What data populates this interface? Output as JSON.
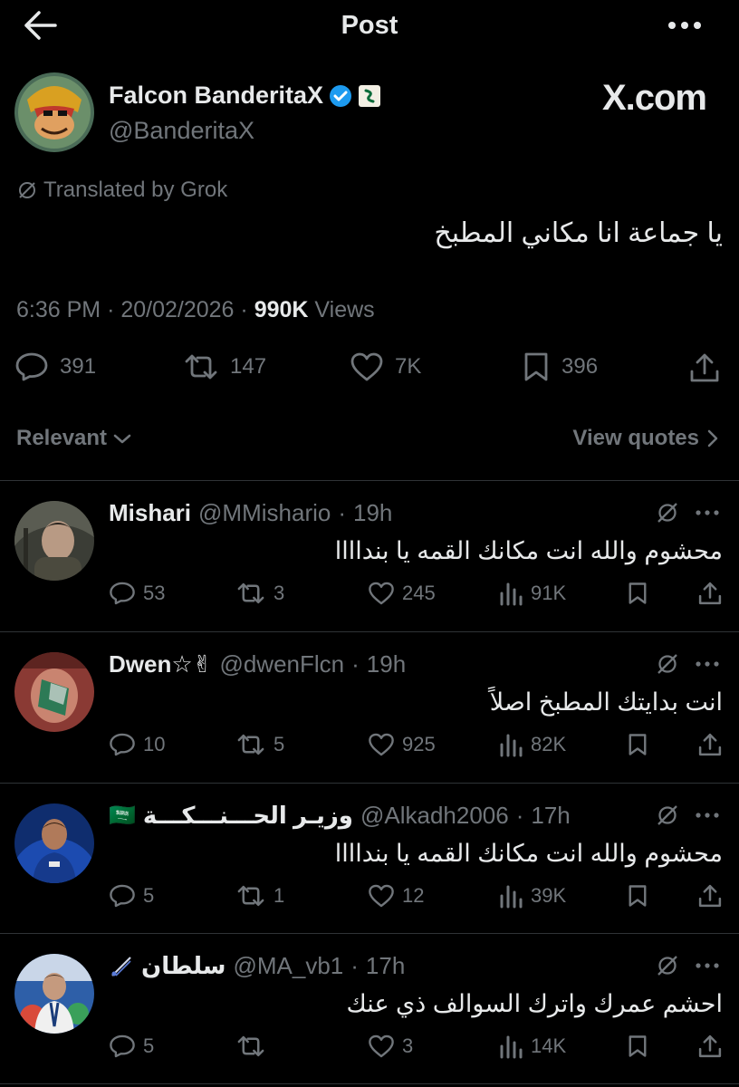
{
  "header": {
    "title": "Post"
  },
  "author": {
    "name": "Falcon BanderitaX",
    "handle": "@BanderitaX",
    "site": "X.com"
  },
  "post": {
    "translated_label": "Translated by Grok",
    "text": "يا جماعة انا مكاني المطبخ",
    "time": "6:36 PM",
    "date": "20/02/2026",
    "views_count": "990K",
    "views_label": "Views",
    "stats": {
      "replies": "391",
      "reposts": "147",
      "likes": "7K",
      "bookmarks": "396"
    }
  },
  "filter": {
    "relevant": "Relevant",
    "view_quotes": "View quotes"
  },
  "colors": {
    "verified": "#1d9bf0",
    "background": "#000000",
    "muted": "#71767b",
    "text": "#e7e9ea"
  },
  "replies": [
    {
      "name": "Mishari",
      "handle": "@MMishario",
      "time": "19h",
      "text": "محشوم والله انت مكانك القمه يا بنداااا",
      "replies": "53",
      "reposts": "3",
      "likes": "245",
      "views": "91K"
    },
    {
      "name": "Dwen☆✌",
      "handle": "@dwenFlcn",
      "time": "19h",
      "text": "انت بدايتك المطبخ اصلاً",
      "replies": "10",
      "reposts": "5",
      "likes": "925",
      "views": "82K"
    },
    {
      "name": "وزيـر الحـــنـــكـــة",
      "flag": "🇸🇦",
      "handle": "@Alkadh2006",
      "time": "17h",
      "text": "محشوم والله انت مكانك القمه يا بنداااا",
      "replies": "5",
      "reposts": "1",
      "likes": "12",
      "views": "39K"
    },
    {
      "name": "سلطان",
      "handle": "@MA_vb1",
      "time": "17h",
      "text": "احشم عمرك واترك السوالف ذي عنك",
      "replies": "5",
      "reposts": "",
      "likes": "3",
      "views": "14K"
    }
  ]
}
